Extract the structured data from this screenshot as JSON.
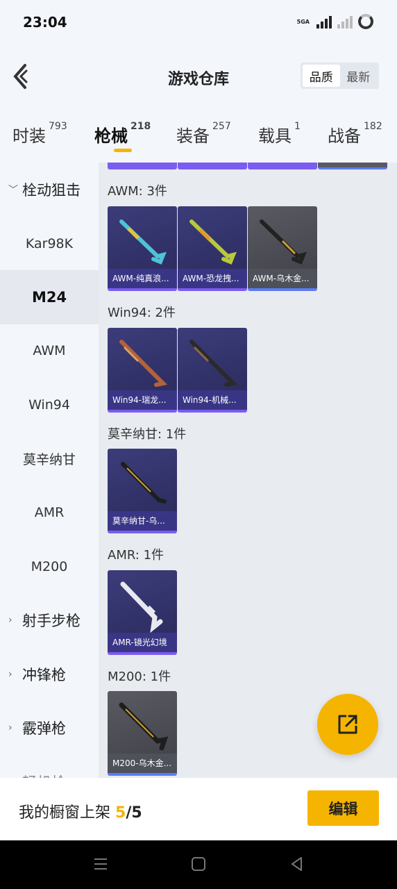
{
  "status_bar": {
    "time": "23:04",
    "network": "5GA"
  },
  "header": {
    "title": "游戏仓库",
    "sort_options": [
      "品质",
      "最新"
    ],
    "active_sort": "品质"
  },
  "tabs": [
    {
      "label": "时装",
      "count": "793"
    },
    {
      "label": "枪械",
      "count": "218",
      "active": true
    },
    {
      "label": "装备",
      "count": "257"
    },
    {
      "label": "载具",
      "count": "1"
    },
    {
      "label": "战备",
      "count": "182"
    }
  ],
  "sidebar": {
    "group_expanded": "栓动狙击",
    "items": [
      "Kar98K",
      "M24",
      "AWM",
      "Win94",
      "莫辛纳甘",
      "AMR",
      "M200"
    ],
    "active_item": "M24",
    "groups_collapsed": [
      "射手步枪",
      "冲锋枪",
      "霰弹枪",
      "轻机枪"
    ]
  },
  "sections": [
    {
      "title": "AWM: 3件",
      "items": [
        {
          "name": "AWM-纯真浪...",
          "rarity": "purple"
        },
        {
          "name": "AWM-恐龙拽...",
          "rarity": "purple"
        },
        {
          "name": "AWM-乌木金...",
          "rarity": "gray"
        }
      ]
    },
    {
      "title": "Win94: 2件",
      "items": [
        {
          "name": "Win94-瑞龙...",
          "rarity": "purple"
        },
        {
          "name": "Win94-机械...",
          "rarity": "purple"
        }
      ]
    },
    {
      "title": "莫辛纳甘: 1件",
      "items": [
        {
          "name": "莫辛纳甘-乌...",
          "rarity": "purple"
        }
      ]
    },
    {
      "title": "AMR: 1件",
      "items": [
        {
          "name": "AMR-镜光幻境",
          "rarity": "purple"
        }
      ]
    },
    {
      "title": "M200: 1件",
      "items": [
        {
          "name": "M200-乌木金...",
          "rarity": "gray"
        }
      ]
    }
  ],
  "bottom_bar": {
    "label": "我的橱窗上架 ",
    "count": "5",
    "total": "/5",
    "edit_label": "编辑"
  },
  "colors": {
    "accent": "#f5b400",
    "purple_rarity": "#7b5df0",
    "gray_rarity": "#5b7cf0"
  },
  "icons": {
    "back": "back-chevron-icon",
    "share": "share-external-icon"
  }
}
